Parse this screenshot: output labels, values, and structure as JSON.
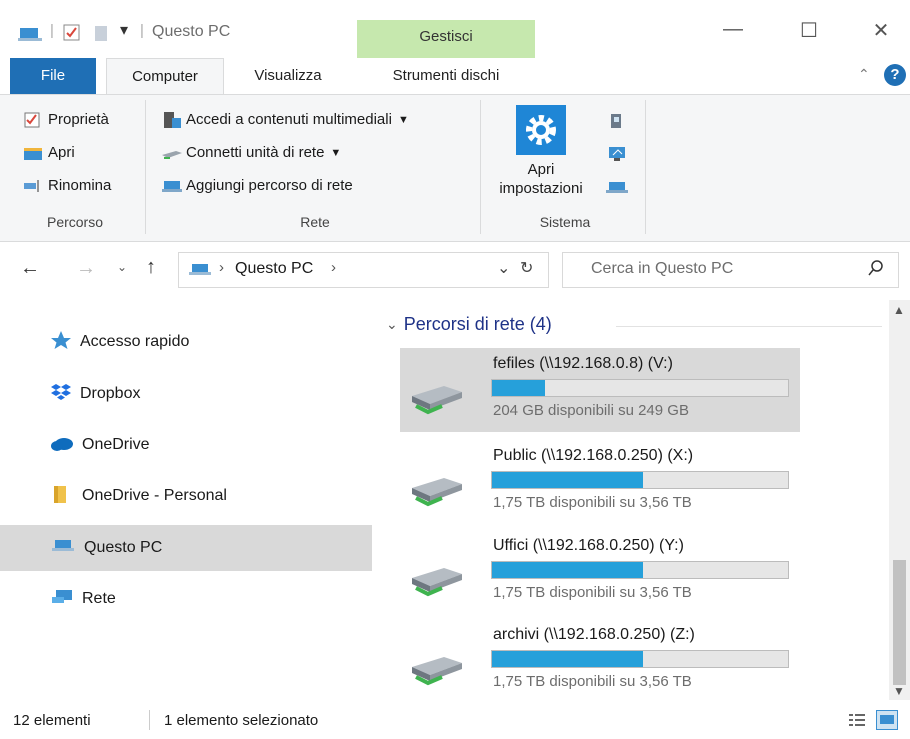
{
  "window": {
    "title": "Questo PC",
    "context_tab_group": "Gestisci",
    "context_color": "#c6e8ae",
    "controls": {
      "minimize": "—",
      "maximize": "☐",
      "close": "✕"
    }
  },
  "ribbon_tabs": [
    {
      "label": "File",
      "active": false,
      "color": "#1f6fb5"
    },
    {
      "label": "Computer",
      "active": true
    },
    {
      "label": "Visualizza",
      "active": false
    },
    {
      "label": "Strumenti dischi",
      "active": false
    }
  ],
  "ribbon": {
    "groups": [
      {
        "label": "Percorso",
        "items": [
          "Proprietà",
          "Apri",
          "Rinomina"
        ]
      },
      {
        "label": "Rete",
        "items": [
          "Accedi a contenuti multimediali",
          "Connetti unità di rete",
          "Aggiungi percorso di rete"
        ]
      },
      {
        "label": "Sistema",
        "items": [
          "Apri impostazioni"
        ]
      }
    ],
    "open_settings_line1": "Apri",
    "open_settings_line2": "impostazioni"
  },
  "address": {
    "breadcrumb": "Questo PC",
    "search_placeholder": "Cerca in Questo PC"
  },
  "nav": {
    "items": [
      {
        "label": "Accesso rapido",
        "icon": "star-icon"
      },
      {
        "label": "Dropbox",
        "icon": "dropbox-icon"
      },
      {
        "label": "OneDrive",
        "icon": "cloud-icon"
      },
      {
        "label": "OneDrive - Personal",
        "icon": "folder-icon"
      },
      {
        "label": "Questo PC",
        "icon": "computer-icon",
        "selected": true
      },
      {
        "label": "Rete",
        "icon": "network-icon"
      }
    ]
  },
  "content": {
    "group_header": "Percorsi di rete (4)",
    "drives": [
      {
        "name": "fefiles (\\\\192.168.0.8) (V:)",
        "free_text": "204 GB disponibili su 249 GB",
        "used_fraction": 0.18,
        "selected": true
      },
      {
        "name": "Public (\\\\192.168.0.250) (X:)",
        "free_text": "1,75 TB disponibili su 3,56 TB",
        "used_fraction": 0.51
      },
      {
        "name": "Uffici (\\\\192.168.0.250) (Y:)",
        "free_text": "1,75 TB disponibili su 3,56 TB",
        "used_fraction": 0.51
      },
      {
        "name": "archivi (\\\\192.168.0.250) (Z:)",
        "free_text": "1,75 TB disponibili su 3,56 TB",
        "used_fraction": 0.51
      }
    ],
    "bar_color": "#26a0da"
  },
  "status": {
    "count": "12 elementi",
    "selection": "1 elemento selezionato"
  }
}
